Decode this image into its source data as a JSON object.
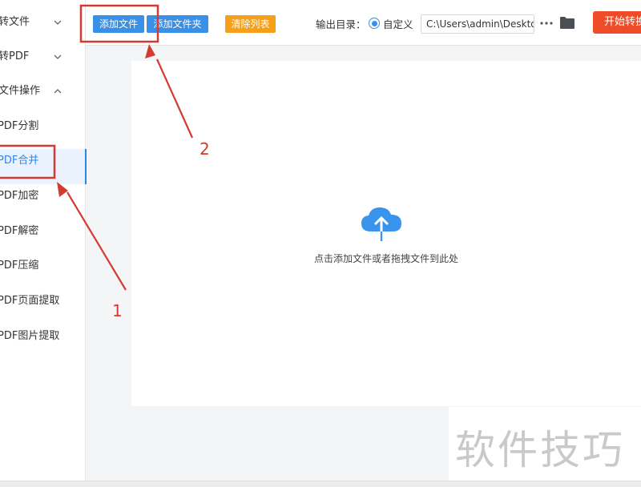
{
  "sidebar": {
    "groups": [
      {
        "label": "转文件",
        "expanded": false
      },
      {
        "label": "转PDF",
        "expanded": false
      },
      {
        "label": "文件操作",
        "expanded": true
      }
    ],
    "items": [
      {
        "label": "PDF分割"
      },
      {
        "label": "PDF合并",
        "active": true
      },
      {
        "label": "PDF加密"
      },
      {
        "label": "PDF解密"
      },
      {
        "label": "PDF压缩"
      },
      {
        "label": "PDF页面提取"
      },
      {
        "label": "PDF图片提取"
      }
    ]
  },
  "toolbar": {
    "add_file": "添加文件",
    "add_folder": "添加文件夹",
    "clear_list": "清除列表",
    "output_label": "输出目录：",
    "custom_option": "自定义",
    "path_value": "C:\\Users\\admin\\Deskto",
    "start_button": "开始转换"
  },
  "dropzone": {
    "hint": "点击添加文件或者拖拽文件到此处"
  },
  "annotations": {
    "label_1": "1",
    "label_2": "2"
  },
  "watermark": "软件技巧",
  "colors": {
    "accent_blue": "#3a8fe6",
    "clear_orange": "#f6a01a",
    "start_red": "#ee4c29",
    "annotation_red": "#d43a32"
  }
}
